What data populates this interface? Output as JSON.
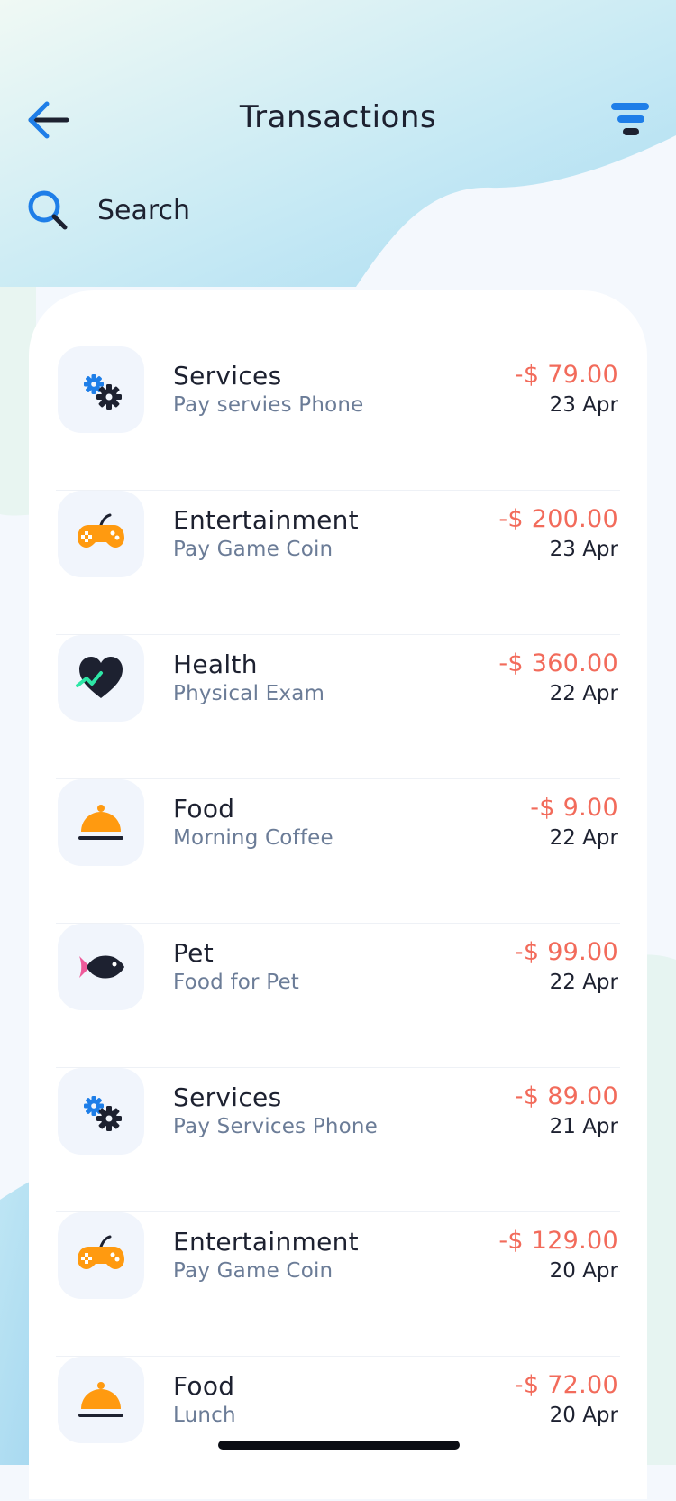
{
  "header": {
    "title": "Transactions",
    "back_icon": "arrow-left-icon",
    "filter_icon": "filter-icon"
  },
  "search": {
    "placeholder": "Search",
    "icon": "search-icon"
  },
  "colors": {
    "accent_blue": "#1e7ee8",
    "amount_red": "#f26b5b",
    "category_orange": "#ff9a10",
    "text_dark": "#1d2130",
    "text_muted": "#6b7c97"
  },
  "transactions": [
    {
      "category": "Services",
      "description": "Pay servies Phone",
      "amount": "-$ 79.00",
      "date": "23 Apr",
      "icon": "gears-icon"
    },
    {
      "category": "Entertainment",
      "description": "Pay Game Coin",
      "amount": "-$ 200.00",
      "date": "23 Apr",
      "icon": "gamepad-icon"
    },
    {
      "category": "Health",
      "description": "Physical Exam",
      "amount": "-$ 360.00",
      "date": "22 Apr",
      "icon": "heart-pulse-icon"
    },
    {
      "category": "Food",
      "description": "Morning Coffee",
      "amount": "-$ 9.00",
      "date": "22 Apr",
      "icon": "food-cloche-icon"
    },
    {
      "category": "Pet",
      "description": "Food for Pet",
      "amount": "-$ 99.00",
      "date": "22 Apr",
      "icon": "fish-icon"
    },
    {
      "category": "Services",
      "description": "Pay Services Phone",
      "amount": "-$ 89.00",
      "date": "21 Apr",
      "icon": "gears-icon"
    },
    {
      "category": "Entertainment",
      "description": "Pay Game Coin",
      "amount": "-$ 129.00",
      "date": "20 Apr",
      "icon": "gamepad-icon"
    },
    {
      "category": "Food",
      "description": "Lunch",
      "amount": "-$ 72.00",
      "date": "20 Apr",
      "icon": "food-cloche-icon"
    }
  ]
}
